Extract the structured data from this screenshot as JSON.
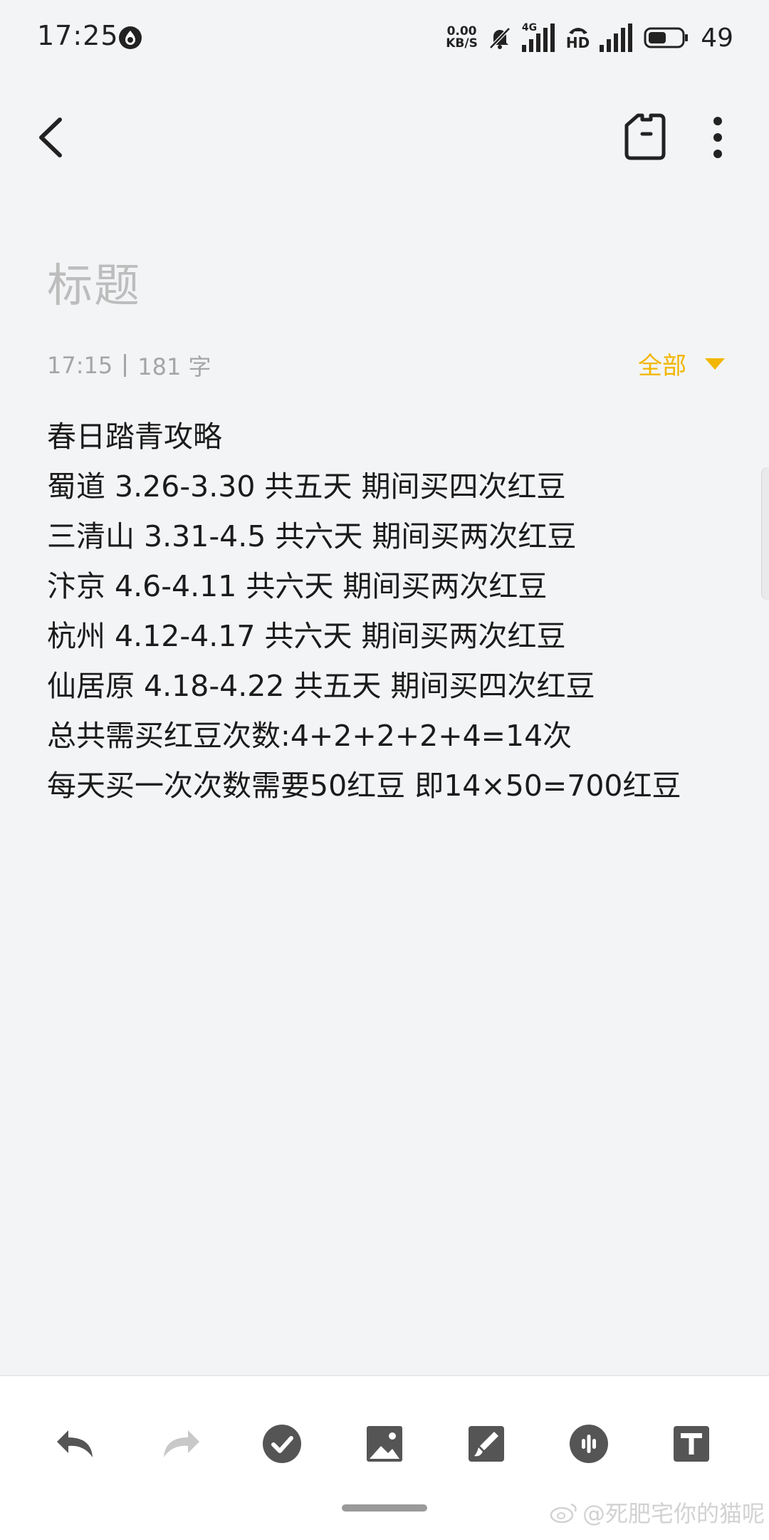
{
  "status_bar": {
    "time": "17:25",
    "net_speed_value": "0.00",
    "net_speed_unit": "KB/S",
    "network_label": "4G",
    "hd_label": "HD",
    "battery_level": "49"
  },
  "note": {
    "title_placeholder": "标题",
    "time": "17:15",
    "word_count": "181 字",
    "folder": "全部",
    "lines": [
      "春日踏青攻略",
      "蜀道 3.26-3.30 共五天 期间买四次红豆",
      "三清山 3.31-4.5 共六天 期间买两次红豆",
      "汴京 4.6-4.11 共六天 期间买两次红豆",
      "杭州 4.12-4.17 共六天 期间买两次红豆",
      "仙居原 4.18-4.22 共五天 期间买四次红豆",
      "总共需买红豆次数:4+2+2+2+4=14次",
      "每天买一次次数需要50红豆 即14×50=700红豆"
    ]
  },
  "watermark": "@死肥宅你的猫呢",
  "colors": {
    "accent": "#f2b600",
    "background": "#f3f4f6",
    "toolbar_icon": "#555555",
    "toolbar_icon_disabled": "#c8c8c8"
  },
  "icons": {
    "back": "back-arrow-icon",
    "tag": "tag-icon",
    "more": "more-vertical-icon",
    "undo": "undo-icon",
    "redo": "redo-icon",
    "checklist": "check-circle-icon",
    "image": "image-icon",
    "brush": "brush-icon",
    "voice": "voice-icon",
    "text_format": "text-format-icon"
  }
}
